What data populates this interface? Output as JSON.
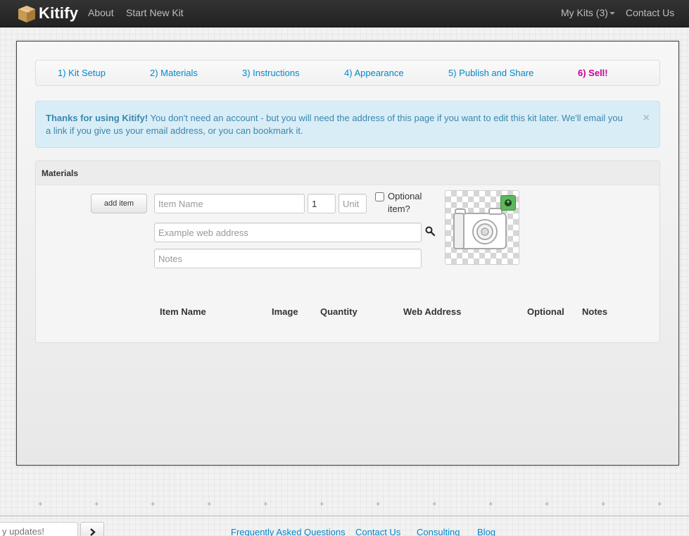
{
  "navbar": {
    "brand": "Kitify",
    "about": "About",
    "start_new_kit": "Start New Kit",
    "my_kits": "My Kits (3)",
    "contact_us": "Contact Us"
  },
  "steps": [
    {
      "label": "1) Kit Setup"
    },
    {
      "label": "2) Materials"
    },
    {
      "label": "3) Instructions"
    },
    {
      "label": "4) Appearance"
    },
    {
      "label": "5) Publish and Share"
    },
    {
      "label": "6) Sell!"
    }
  ],
  "alert": {
    "strong": "Thanks for using Kitify!",
    "text": " You don't need an account - but you will need the address of this page if you want to edit this kit later. We'll email you a link if you give us your email address, or you can bookmark it.",
    "close": "×"
  },
  "materials": {
    "heading": "Materials",
    "add_item_label": "add item",
    "item_name_placeholder": "Item Name",
    "quantity_value": "1",
    "unit_placeholder": "Unit",
    "optional_label": "Optional item?",
    "web_address_placeholder": "Example web address",
    "notes_placeholder": "Notes",
    "columns": [
      "Item Name",
      "Image",
      "Quantity",
      "Web Address",
      "Optional",
      "Notes"
    ]
  },
  "footer": {
    "newsletter_placeholder": "y updates!",
    "links": [
      "Frequently Asked Questions",
      "Contact Us",
      "Consulting",
      "Blog"
    ]
  },
  "colors": {
    "navbar": "#222222",
    "link": "#0088cc",
    "sell": "#cc0099",
    "alert_bg": "#d9edf7",
    "alert_text": "#3a87ad",
    "add_image_button": "#5cb85c"
  }
}
